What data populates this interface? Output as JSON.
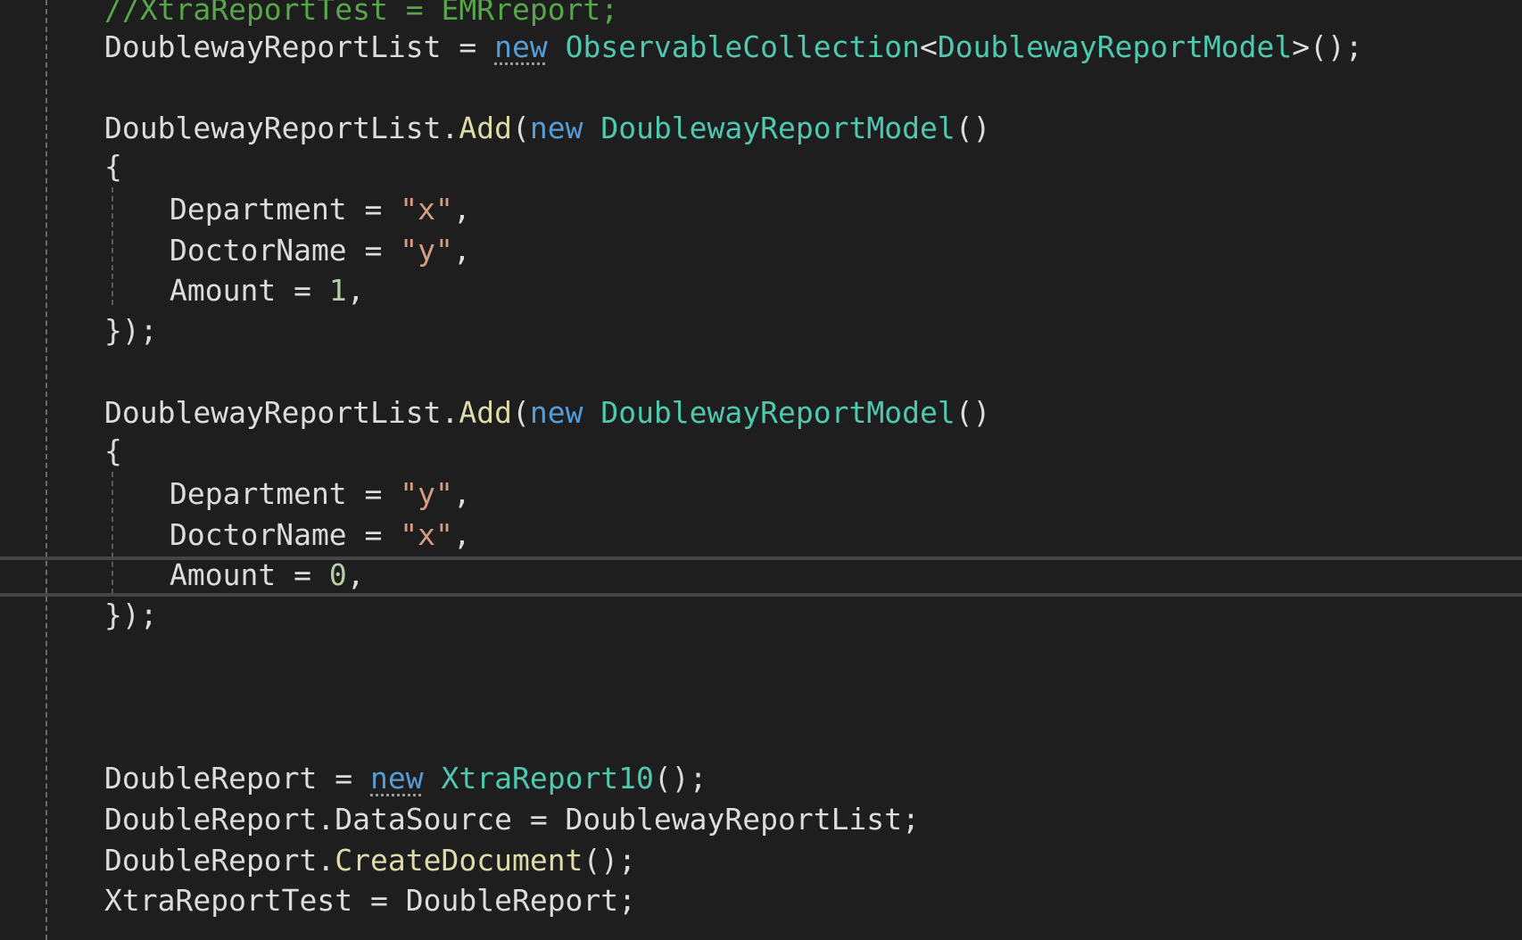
{
  "editor": {
    "lines": [
      [
        {
          "text": "//XtraReportTest = EMRreport;",
          "kind": "comment"
        }
      ],
      [
        {
          "text": "DoublewayReportList",
          "kind": "plain"
        },
        {
          "text": " = ",
          "kind": "plain"
        },
        {
          "text": "new",
          "kind": "kw",
          "squiggle": true
        },
        {
          "text": " ",
          "kind": "plain"
        },
        {
          "text": "ObservableCollection",
          "kind": "type"
        },
        {
          "text": "<",
          "kind": "plain"
        },
        {
          "text": "DoublewayReportModel",
          "kind": "type"
        },
        {
          "text": ">();",
          "kind": "plain"
        }
      ],
      [
        {
          "text": "DoublewayReportList.",
          "kind": "plain"
        },
        {
          "text": "Add",
          "kind": "method"
        },
        {
          "text": "(",
          "kind": "plain"
        },
        {
          "text": "new",
          "kind": "kw"
        },
        {
          "text": " ",
          "kind": "plain"
        },
        {
          "text": "DoublewayReportModel",
          "kind": "type"
        },
        {
          "text": "()",
          "kind": "plain"
        }
      ],
      [
        {
          "text": "{",
          "kind": "plain"
        }
      ],
      [
        {
          "text": "Department = ",
          "kind": "plain"
        },
        {
          "text": "\"x\"",
          "kind": "str"
        },
        {
          "text": ",",
          "kind": "plain"
        }
      ],
      [
        {
          "text": "DoctorName = ",
          "kind": "plain"
        },
        {
          "text": "\"y\"",
          "kind": "str"
        },
        {
          "text": ",",
          "kind": "plain"
        }
      ],
      [
        {
          "text": "Amount = ",
          "kind": "plain"
        },
        {
          "text": "1",
          "kind": "num"
        },
        {
          "text": ",",
          "kind": "plain"
        }
      ],
      [
        {
          "text": "});",
          "kind": "plain"
        }
      ],
      [
        {
          "text": "DoublewayReportList.",
          "kind": "plain"
        },
        {
          "text": "Add",
          "kind": "method"
        },
        {
          "text": "(",
          "kind": "plain"
        },
        {
          "text": "new",
          "kind": "kw"
        },
        {
          "text": " ",
          "kind": "plain"
        },
        {
          "text": "DoublewayReportModel",
          "kind": "type"
        },
        {
          "text": "()",
          "kind": "plain"
        }
      ],
      [
        {
          "text": "{",
          "kind": "plain"
        }
      ],
      [
        {
          "text": "Department = ",
          "kind": "plain"
        },
        {
          "text": "\"y\"",
          "kind": "str"
        },
        {
          "text": ",",
          "kind": "plain"
        }
      ],
      [
        {
          "text": "DoctorName = ",
          "kind": "plain"
        },
        {
          "text": "\"x\"",
          "kind": "str"
        },
        {
          "text": ",",
          "kind": "plain"
        }
      ],
      [
        {
          "text": "Amount = ",
          "kind": "plain"
        },
        {
          "text": "0",
          "kind": "num"
        },
        {
          "text": ",",
          "kind": "plain"
        }
      ],
      [
        {
          "text": "});",
          "kind": "plain"
        }
      ],
      [
        {
          "text": "DoubleReport = ",
          "kind": "plain"
        },
        {
          "text": "new",
          "kind": "kw",
          "squiggle": true
        },
        {
          "text": " ",
          "kind": "plain"
        },
        {
          "text": "XtraReport10",
          "kind": "type"
        },
        {
          "text": "();",
          "kind": "plain"
        }
      ],
      [
        {
          "text": "DoubleReport.DataSource = DoublewayReportList;",
          "kind": "plain"
        }
      ],
      [
        {
          "text": "DoubleReport.",
          "kind": "plain"
        },
        {
          "text": "CreateDocument",
          "kind": "method"
        },
        {
          "text": "();",
          "kind": "plain"
        }
      ],
      [
        {
          "text": "XtraReportTest = DoubleReport;",
          "kind": "plain"
        }
      ]
    ]
  },
  "colors": {
    "background": "#1e1e1e",
    "plain": "#dcdcdc",
    "keyword": "#569cd6",
    "type": "#4ec9b0",
    "method": "#dcdcaa",
    "string": "#d69d85",
    "number": "#b5cea8",
    "comment": "#57a64a"
  }
}
